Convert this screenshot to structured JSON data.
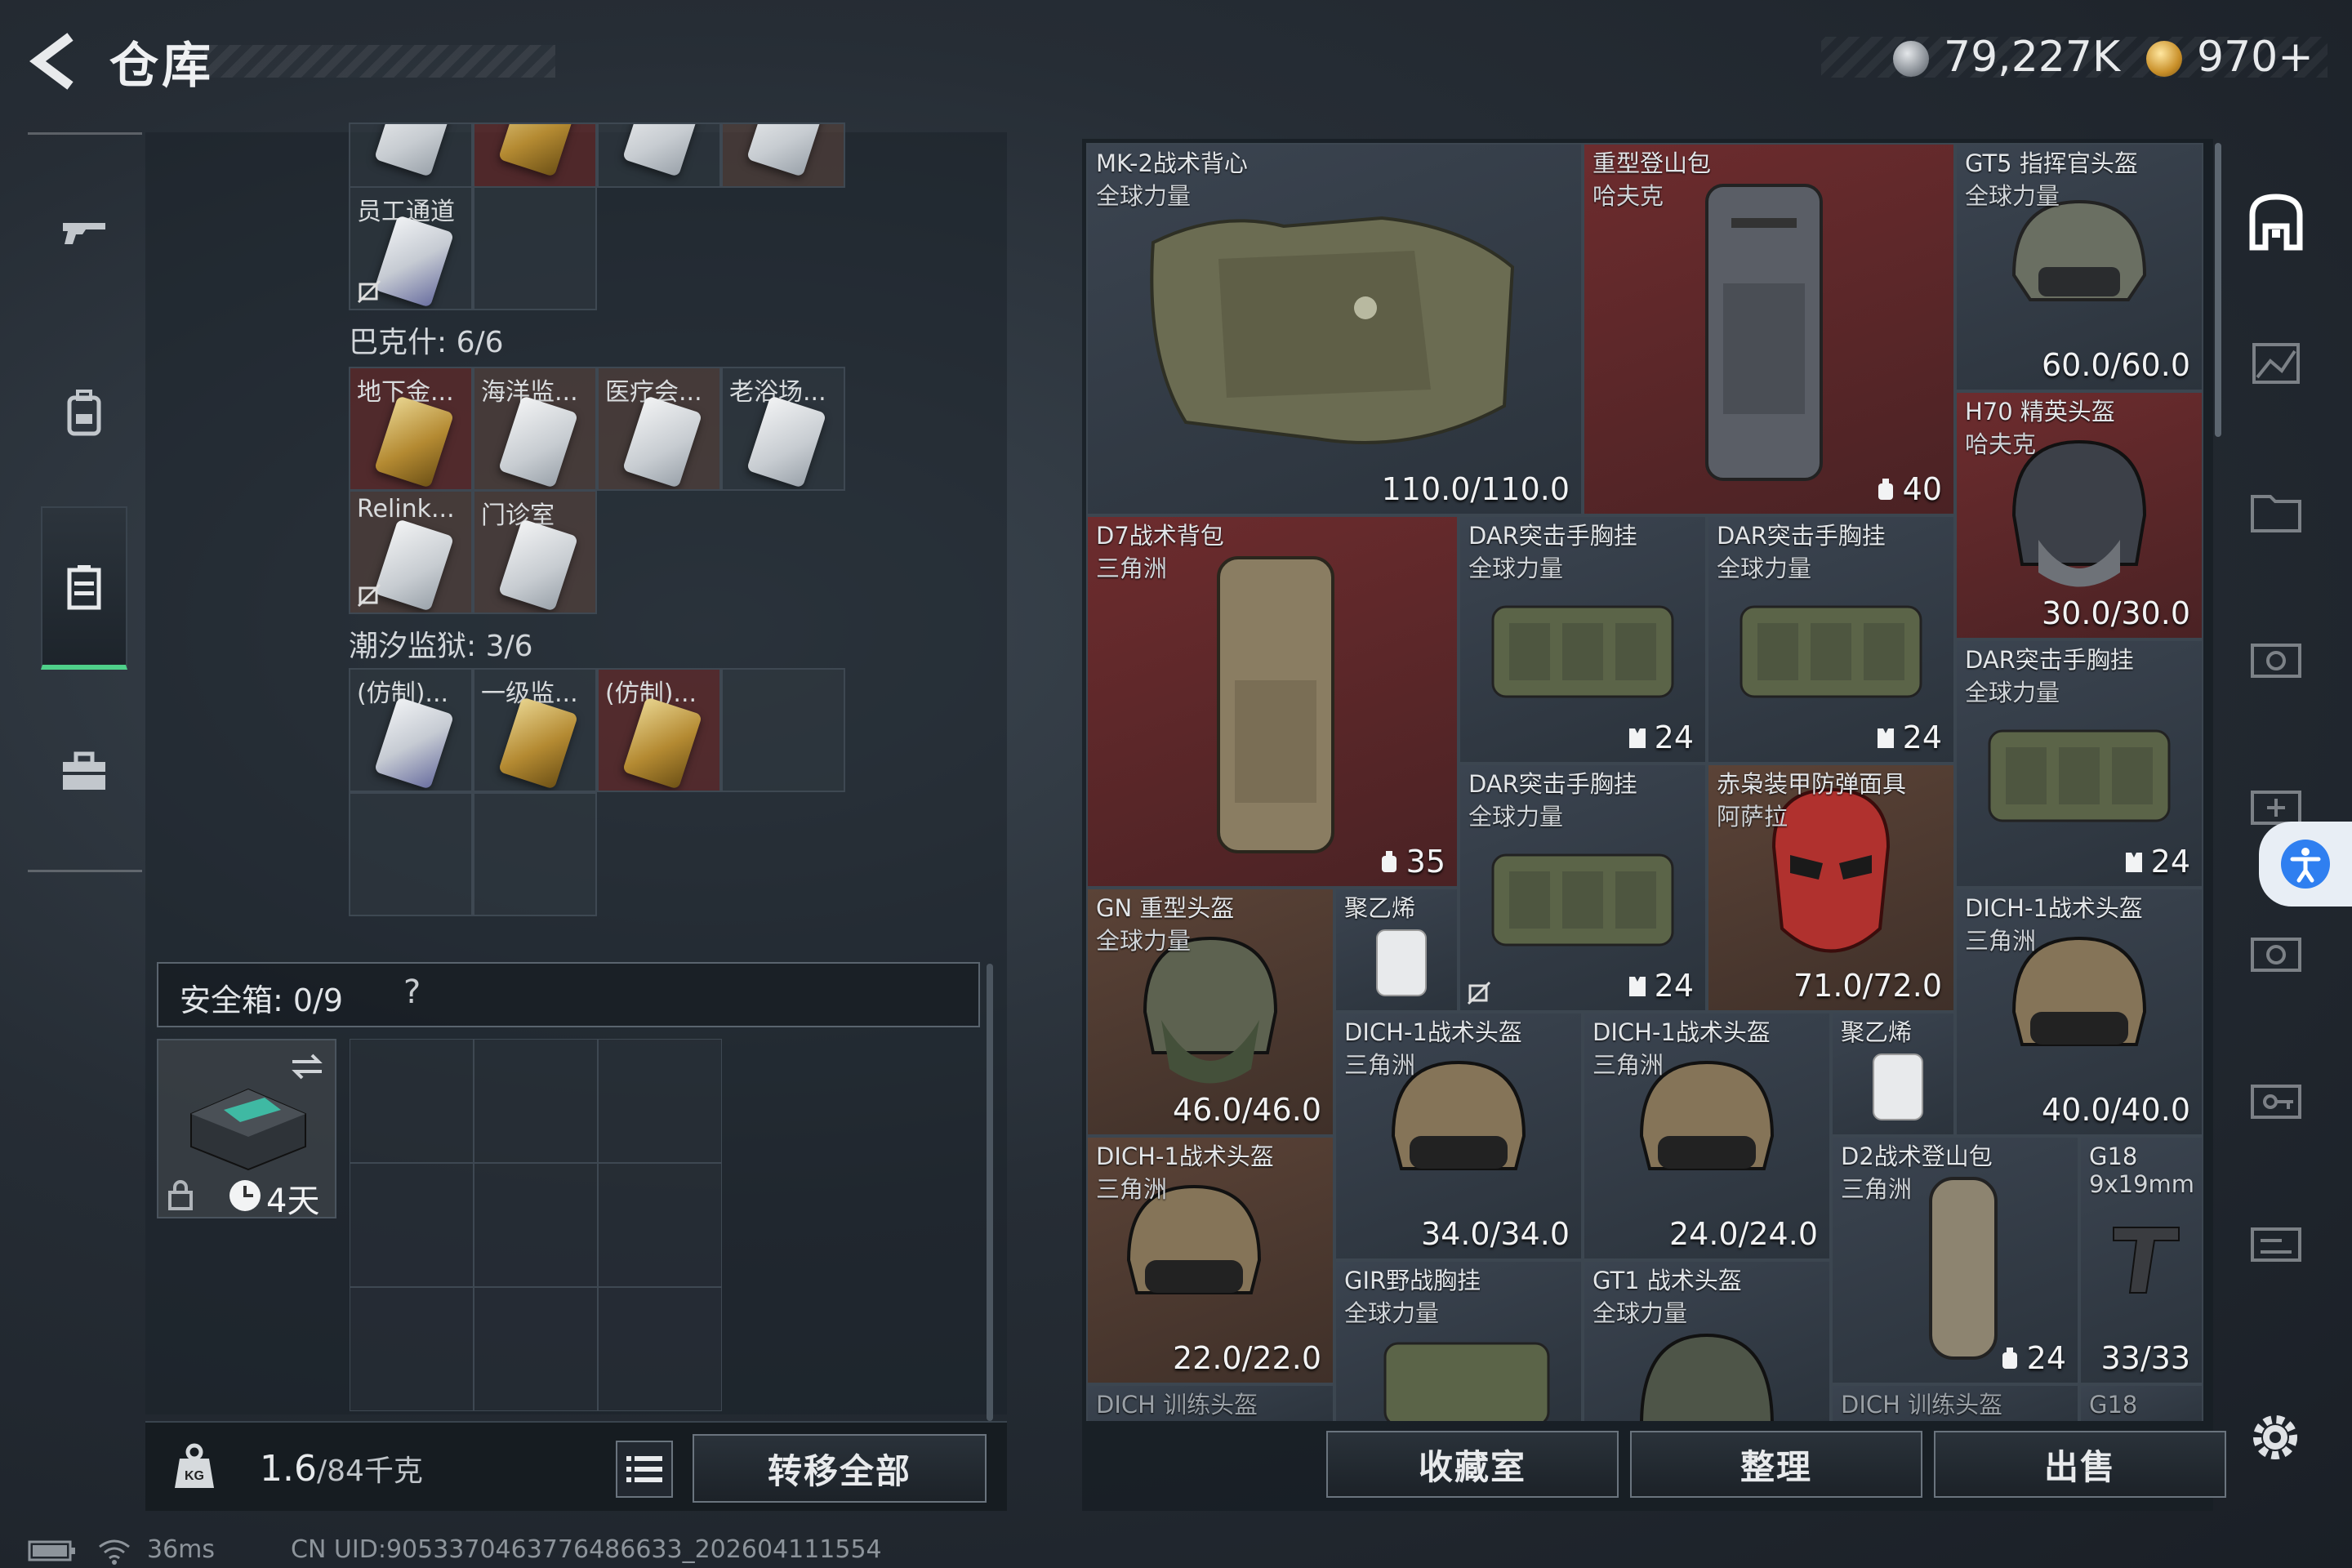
{
  "header": {
    "title": "仓库",
    "silver_amount": "79,227K",
    "gold_amount": "970+"
  },
  "left_nav": {
    "items": [
      {
        "icon": "gun-icon",
        "active": false
      },
      {
        "icon": "backpack-icon",
        "active": false
      },
      {
        "icon": "storage-icon",
        "active": true
      },
      {
        "icon": "briefcase-icon",
        "active": false
      }
    ]
  },
  "stash": {
    "top_row_partial": [
      "",
      "",
      "",
      ""
    ],
    "staff_card": "员工通道",
    "section_bakesh": "巴克什: 6/6",
    "bakesh_cards": [
      "地下金...",
      "海洋监...",
      "医疗会...",
      "老浴场...",
      "Relink...",
      "门诊室"
    ],
    "section_tide": "潮汐监狱: 3/6",
    "tide_cards": [
      "(仿制)...",
      "一级监...",
      "(仿制)..."
    ]
  },
  "safebox": {
    "label": "安全箱: 0/9",
    "help": "?",
    "timer": "4天"
  },
  "weight": {
    "current": "1.6",
    "max": "/84千克"
  },
  "buttons": {
    "transfer_all": "转移全部",
    "collection": "收藏室",
    "organize": "整理",
    "sell": "出售"
  },
  "inventory": [
    {
      "name": "MK-2战术背心",
      "sub": "全球力量",
      "value": "110.0/110.0"
    },
    {
      "name": "重型登山包",
      "sub": "哈夫克",
      "value": "40"
    },
    {
      "name": "GT5 指挥官头盔",
      "sub": "全球力量",
      "value": "60.0/60.0"
    },
    {
      "name": "H70 精英头盔",
      "sub": "哈夫克",
      "value": "30.0/30.0"
    },
    {
      "name": "D7战术背包",
      "sub": "三角洲",
      "value": "35"
    },
    {
      "name": "DAR突击手胸挂",
      "sub": "全球力量",
      "value": "24"
    },
    {
      "name": "DAR突击手胸挂",
      "sub": "全球力量",
      "value": "24"
    },
    {
      "name": "DAR突击手胸挂",
      "sub": "全球力量",
      "value": "24"
    },
    {
      "name": "DAR突击手胸挂",
      "sub": "全球力量",
      "value": "24"
    },
    {
      "name": "赤枭装甲防弹面具",
      "sub": "阿萨拉",
      "value": "71.0/72.0"
    },
    {
      "name": "GN 重型头盔",
      "sub": "全球力量",
      "value": "46.0/46.0"
    },
    {
      "name": "聚乙烯",
      "sub": "",
      "value": ""
    },
    {
      "name": "DICH-1战术头盔",
      "sub": "三角洲",
      "value": "40.0/40.0"
    },
    {
      "name": "DICH-1战术头盔",
      "sub": "三角洲",
      "value": "34.0/34.0"
    },
    {
      "name": "DICH-1战术头盔",
      "sub": "三角洲",
      "value": "24.0/24.0"
    },
    {
      "name": "聚乙烯",
      "sub": "",
      "value": ""
    },
    {
      "name": "DICH-1战术头盔",
      "sub": "三角洲",
      "value": "22.0/22.0"
    },
    {
      "name": "D2战术登山包",
      "sub": "三角洲",
      "value": "24"
    },
    {
      "name": "G18",
      "sub": "9x19mm",
      "value": "33/33"
    },
    {
      "name": "GIR野战胸挂",
      "sub": "全球力量",
      "value": ""
    },
    {
      "name": "GT1 战术头盔",
      "sub": "全球力量",
      "value": ""
    },
    {
      "name": "DICH 训练头盔",
      "sub": "",
      "value": ""
    },
    {
      "name": "DICH 训练头盔",
      "sub": "",
      "value": ""
    },
    {
      "name": "G18",
      "sub": "",
      "value": ""
    }
  ],
  "status": {
    "ping": "36ms",
    "uid": "CN UID:9053370463776486633_202604111554"
  },
  "colors": {
    "accent_green": "#4fd08a",
    "item_red": "#6d2c2e",
    "item_dark": "#3b4450",
    "item_brown": "#5b4337"
  }
}
